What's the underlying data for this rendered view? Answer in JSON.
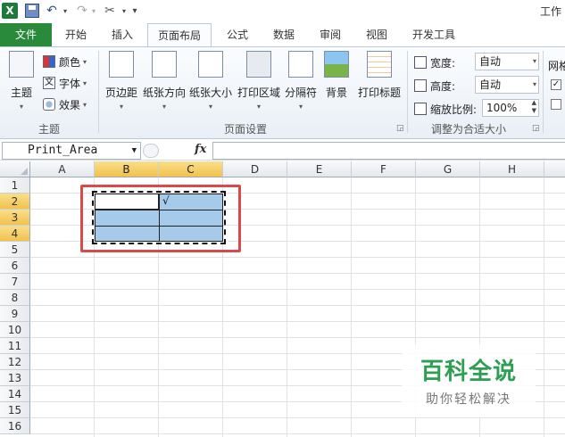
{
  "window": {
    "title": "工作"
  },
  "quick_access": {
    "app_icon": "X",
    "save_icon": "save-icon",
    "undo_icon": "↶",
    "redo_icon": "↷",
    "tool_icon": "✂",
    "more": "▾",
    "dropdown": "▾"
  },
  "tabs": [
    {
      "label": "文件"
    },
    {
      "label": "开始"
    },
    {
      "label": "插入"
    },
    {
      "label": "页面布局"
    },
    {
      "label": "公式"
    },
    {
      "label": "数据"
    },
    {
      "label": "审阅"
    },
    {
      "label": "视图"
    },
    {
      "label": "开发工具"
    }
  ],
  "ribbon": {
    "theme_group": {
      "theme_label": "主题",
      "colors_label": "颜色",
      "fonts_label": "字体",
      "effects_label": "效果",
      "group_label": "主题"
    },
    "page_setup": {
      "margins": "页边距",
      "orientation": "纸张方向",
      "size": "纸张大小",
      "print_area": "打印区域",
      "breaks": "分隔符",
      "background": "背景",
      "print_titles": "打印标题",
      "group_label": "页面设置"
    },
    "scale_to_fit": {
      "width_label": "宽度:",
      "width_value": "自动",
      "height_label": "高度:",
      "height_value": "自动",
      "scale_label": "缩放比例:",
      "scale_value": "100%",
      "group_label": "调整为合适大小"
    },
    "sheet_options": {
      "gridlines_label": "网格"
    }
  },
  "formula_bar": {
    "name_box": "Print_Area",
    "fx": "fx",
    "formula": ""
  },
  "sheet": {
    "columns": [
      "A",
      "B",
      "C",
      "D",
      "E",
      "F",
      "G",
      "H"
    ],
    "rows": [
      "1",
      "2",
      "3",
      "4",
      "5",
      "6",
      "7",
      "8",
      "9",
      "10",
      "11",
      "12",
      "13",
      "14",
      "15",
      "16"
    ],
    "selected_columns": [
      "B",
      "C"
    ],
    "selected_rows": [
      "2",
      "3",
      "4"
    ],
    "cell_c2": "√"
  },
  "watermark": {
    "title": "百科全说",
    "subtitle": "助你轻松解决"
  },
  "colors": {
    "file_tab": "#2a8a3c",
    "selection_fill": "#a6cbea",
    "header_highlight": "#f2c14e",
    "annotation_red": "#d94a4a",
    "watermark_green": "#2e9e52"
  }
}
